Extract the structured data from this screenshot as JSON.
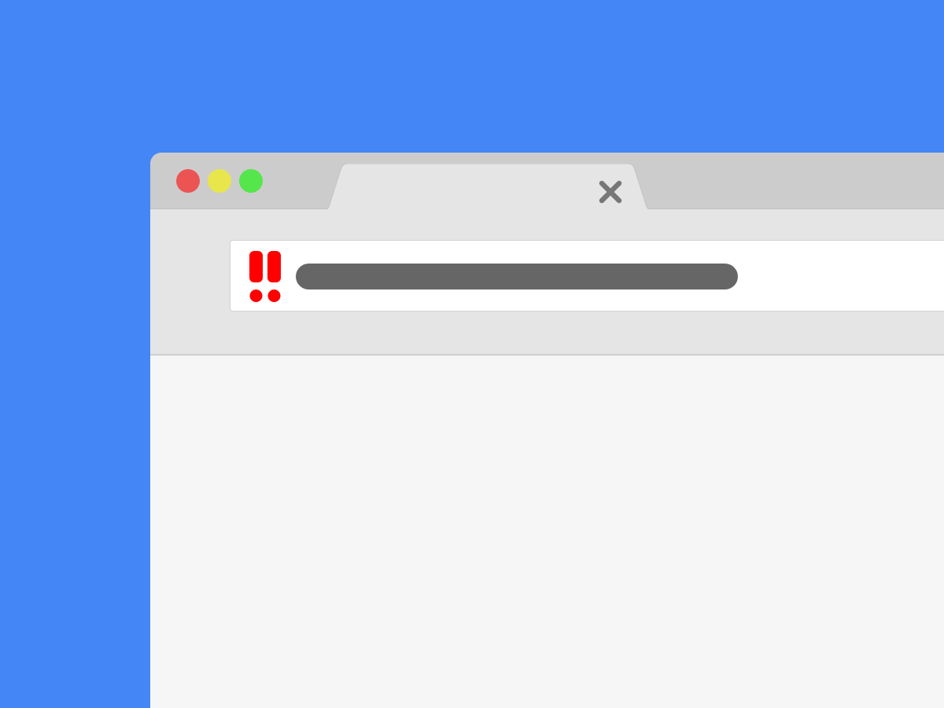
{
  "window": {
    "frame_color": "#cccccc",
    "controls": [
      {
        "name": "close",
        "color": "#ec5454"
      },
      {
        "name": "minimize",
        "color": "#e8e64a"
      },
      {
        "name": "maximize",
        "color": "#54e64a"
      }
    ]
  },
  "tab": {
    "color": "#e5e5e5",
    "close_icon": "x-close-icon",
    "close_icon_color": "#777777"
  },
  "address_bar": {
    "security_icon": "double-exclamation-warning-icon",
    "security_icon_color": "#ff0000",
    "url_placeholder_color": "#666666"
  },
  "page": {
    "background": "#4486f6",
    "content_background": "#f6f6f6"
  }
}
